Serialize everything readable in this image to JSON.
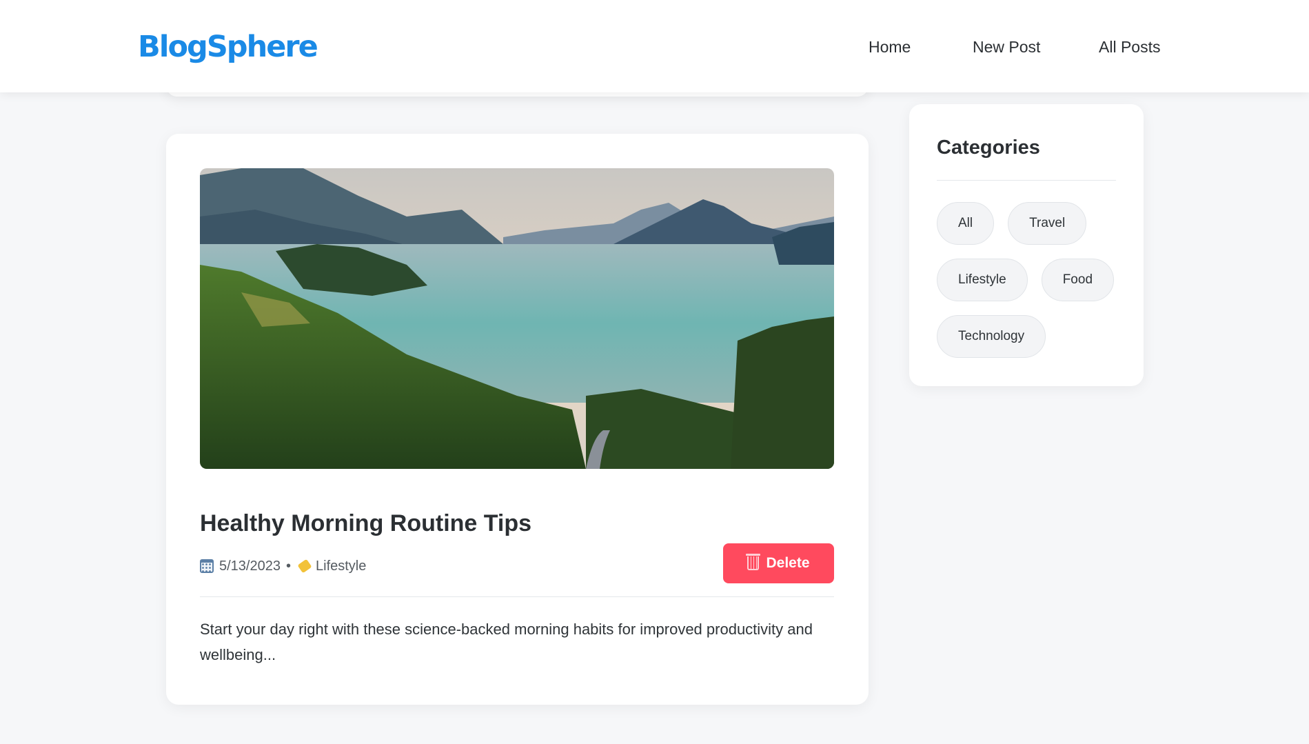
{
  "header": {
    "logo": "BlogSphere",
    "nav": [
      {
        "label": "Home"
      },
      {
        "label": "New Post"
      },
      {
        "label": "All Posts"
      }
    ]
  },
  "post": {
    "title": "Healthy Morning Routine Tips",
    "date": "5/13/2023",
    "separator": "•",
    "category": "Lifestyle",
    "delete_label": "Delete",
    "excerpt": "Start your day right with these science-backed morning habits for improved productivity and wellbeing..."
  },
  "sidebar": {
    "title": "Categories",
    "categories": [
      {
        "label": "All"
      },
      {
        "label": "Travel"
      },
      {
        "label": "Lifestyle"
      },
      {
        "label": "Food"
      },
      {
        "label": "Technology"
      }
    ]
  },
  "colors": {
    "brand": "#1a8ae6",
    "delete": "#ff4a5e",
    "background": "#f6f7f9"
  },
  "icons": {
    "date": "calendar-icon",
    "category": "tag-icon",
    "delete": "trash-icon"
  }
}
